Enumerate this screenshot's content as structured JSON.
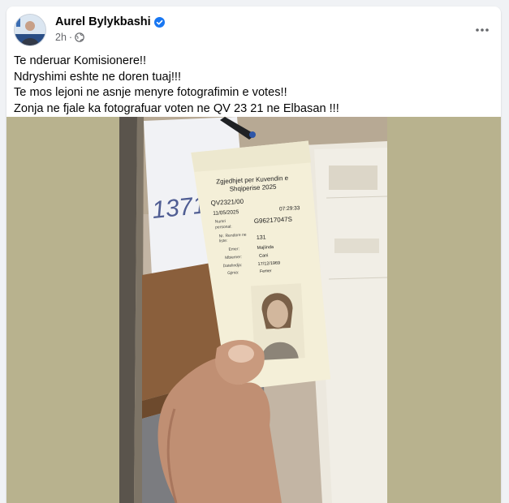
{
  "post": {
    "author": "Aurel Bylykbashi",
    "timestamp": "2h",
    "lines": [
      "Te nderuar Komisionere!!",
      "Ndryshimi eshte ne doren tuaj!!!",
      "Te mos lejoni ne asnje menyre fotografimin e votes!!",
      "Zonja ne fjale ka fotografuar voten ne QV 23 21 ne Elbasan !!!"
    ]
  },
  "ballot": {
    "title_line1": "Zgjedhjet per Kuvendin e",
    "title_line2": "Shqiperise 2025",
    "code": "QV2321/00",
    "date": "11/05/2025",
    "time": "07:29:33",
    "personal_label_1": "Numri",
    "personal_label_2": "personal:",
    "personal_value": "G96217047S",
    "list_label_1": "Nr. Rendore ne",
    "list_label_2": "liste:",
    "list_value": "131",
    "name_label": "Emer:",
    "name_value": "Majlinda",
    "surname_label": "Mbiemer:",
    "surname_value": "Cani",
    "dob_label": "Datelindja:",
    "dob_value": "17/12/1969",
    "gender_label": "Gjinia:",
    "gender_value": "Femer"
  },
  "note": {
    "handwritten": "1371"
  },
  "icons": {
    "verified": "verified-badge-icon",
    "audience": "globe-icon",
    "more": "more-dots-icon"
  },
  "colors": {
    "verified": "#1877f2",
    "text_secondary": "#65676b",
    "media_bg": "#b8b28e"
  }
}
